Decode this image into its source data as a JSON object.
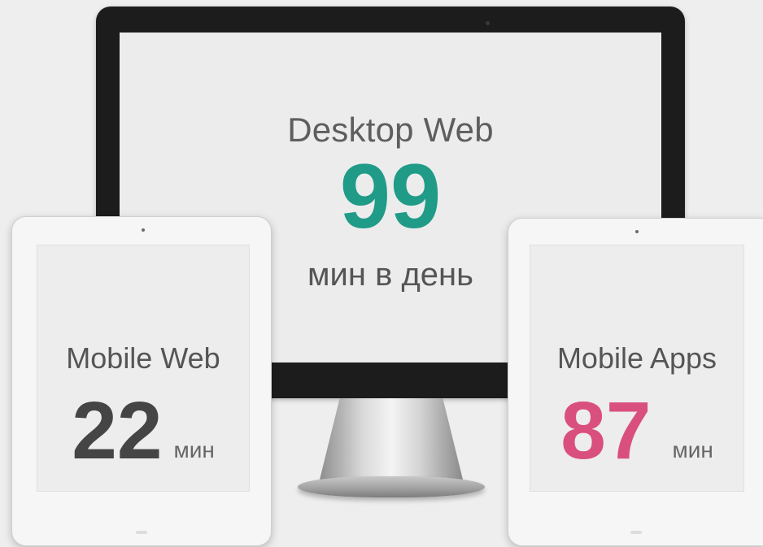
{
  "colors": {
    "background": "#eeeeee",
    "desktop_accent": "#1f9b87",
    "mobile_web_accent": "#454545",
    "mobile_apps_accent": "#d94f7d"
  },
  "desktop": {
    "title": "Desktop Web",
    "value": "99",
    "unit": "мин в день"
  },
  "mobile_web": {
    "title": "Mobile Web",
    "value": "22",
    "unit": "мин"
  },
  "mobile_apps": {
    "title": "Mobile Apps",
    "value": "87",
    "unit": "мин"
  }
}
